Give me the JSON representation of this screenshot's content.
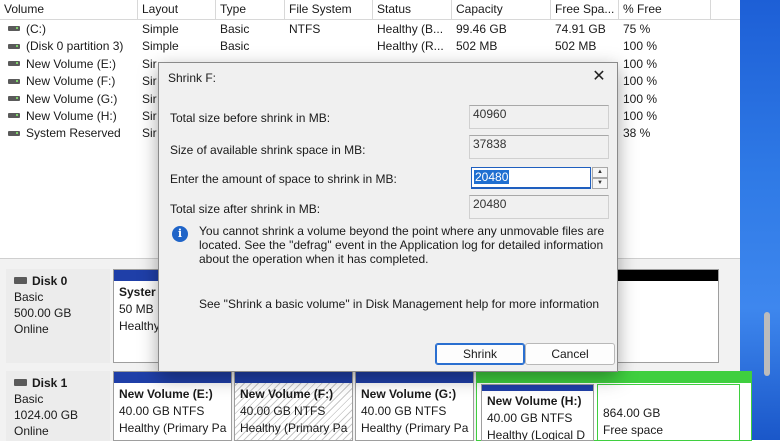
{
  "volume_table": {
    "columns": [
      "Volume",
      "Layout",
      "Type",
      "File System",
      "Status",
      "Capacity",
      "Free Spa...",
      "% Free"
    ],
    "rows": [
      {
        "volume": "(C:)",
        "layout": "Simple",
        "type": "Basic",
        "fs": "NTFS",
        "status": "Healthy (B...",
        "capacity": "99.46 GB",
        "free": "74.91 GB",
        "pct": "75 %"
      },
      {
        "volume": "(Disk 0 partition 3)",
        "layout": "Simple",
        "type": "Basic",
        "fs": "",
        "status": "Healthy (R...",
        "capacity": "502 MB",
        "free": "502 MB",
        "pct": "100 %"
      },
      {
        "volume": "New Volume (E:)",
        "layout": "Sir",
        "type": "",
        "fs": "",
        "status": "",
        "capacity": "",
        "free": "",
        "pct": "100 %"
      },
      {
        "volume": "New Volume (F:)",
        "layout": "Sir",
        "type": "",
        "fs": "",
        "status": "",
        "capacity": "",
        "free": "",
        "pct": "100 %"
      },
      {
        "volume": "New Volume (G:)",
        "layout": "Sir",
        "type": "",
        "fs": "",
        "status": "",
        "capacity": "",
        "free": "",
        "pct": "100 %"
      },
      {
        "volume": "New Volume (H:)",
        "layout": "Sir",
        "type": "",
        "fs": "",
        "status": "",
        "capacity": "",
        "free": "",
        "pct": "100 %"
      },
      {
        "volume": "System Reserved",
        "layout": "Sir",
        "type": "",
        "fs": "",
        "status": "",
        "capacity": "",
        "free": "",
        "pct": "38 %"
      }
    ]
  },
  "disks": [
    {
      "name": "Disk 0",
      "type": "Basic",
      "size": "500.00 GB",
      "state": "Online"
    },
    {
      "name": "Disk 1",
      "type": "Basic",
      "size": "1024.00 GB",
      "state": "Online"
    }
  ],
  "disk0_partitions": [
    {
      "name": "Syster",
      "line2": "50 MB",
      "line3": "Healthy"
    }
  ],
  "disk1_partitions": [
    {
      "name": "New Volume  (E:)",
      "line2": "40.00 GB NTFS",
      "line3": "Healthy (Primary Pa"
    },
    {
      "name": "New Volume  (F:)",
      "line2": "40.00 GB NTFS",
      "line3": "Healthy (Primary Pa"
    },
    {
      "name": "New Volume  (G:)",
      "line2": "40.00 GB NTFS",
      "line3": "Healthy (Primary Pa"
    },
    {
      "name": "New Volume  (H:)",
      "line2": "40.00 GB NTFS",
      "line3": "Healthy (Logical D"
    },
    {
      "name": "",
      "line2": "864.00 GB",
      "line3": "Free space"
    }
  ],
  "dialog": {
    "title": "Shrink F:",
    "close_glyph": "✕",
    "fields": [
      {
        "label": "Total size before shrink in MB:",
        "value": "40960"
      },
      {
        "label": "Size of available shrink space in MB:",
        "value": "37838"
      },
      {
        "label": "Enter the amount of space to shrink in MB:",
        "value": "20480"
      },
      {
        "label": "Total size after shrink in MB:",
        "value": "20480"
      }
    ],
    "info_icon_glyph": "i",
    "info_text": "You cannot shrink a volume beyond the point where any unmovable files are located. See the \"defrag\" event in the Application log for detailed information about the operation when it has completed.",
    "help_text": "See \"Shrink a basic volume\" in Disk Management help for more information",
    "shrink_label": "Shrink",
    "cancel_label": "Cancel"
  },
  "colors": {
    "primary_bar": "#1f3fa8",
    "logical_bar": "#1f3fa8",
    "free_space_bar": "#3fcf3f",
    "unallocated_bar": "#000000",
    "selection": "#1f6fd1",
    "info_icon": "#1f64c8"
  },
  "icons": {
    "drive": "drive-icon",
    "disk": "disk-icon",
    "info": "info-icon",
    "close": "close-icon",
    "spin_up": "chevron-up-icon",
    "spin_down": "chevron-down-icon"
  }
}
